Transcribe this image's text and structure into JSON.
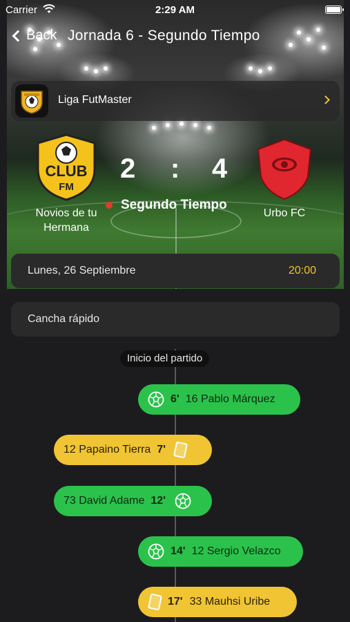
{
  "status_bar": {
    "carrier": "Carrier",
    "time": "2:29 AM"
  },
  "nav": {
    "back_label": "Back",
    "title": "Jornada 6 - Segundo Tiempo"
  },
  "league": {
    "name": "Liga FutMaster",
    "logo_icon": "league-logo-icon"
  },
  "match": {
    "home_team": "Novios de tu Hermana",
    "away_team": "Urbo FC",
    "home_score": "2",
    "separator": ":",
    "away_score": "4",
    "period": "Segundo Tiempo",
    "home_logo_text": "CLUB",
    "home_logo_subtext": "FM"
  },
  "details": {
    "date": "Lunes, 26 Septiembre",
    "time": "20:00",
    "venue": "Cancha rápido"
  },
  "timeline": {
    "start_label": "Inicio del partido",
    "events": [
      {
        "type": "goal",
        "side": "away",
        "minute": "6'",
        "player": "16 Pablo Márquez"
      },
      {
        "type": "card",
        "side": "home",
        "minute": "7'",
        "player": "12 Papaino Tierra"
      },
      {
        "type": "goal",
        "side": "home",
        "minute": "12'",
        "player": "73 David Adame"
      },
      {
        "type": "goal",
        "side": "away",
        "minute": "14'",
        "player": "12 Sergio Velazco"
      },
      {
        "type": "card",
        "side": "away",
        "minute": "17'",
        "player": "33 Mauhsi Uribe"
      }
    ]
  },
  "colors": {
    "accent": "#f2c230",
    "goal": "#2bc24c",
    "card": "#f0c433",
    "live_dot": "#e03b2c",
    "background": "#1c1c1e",
    "away_crest": "#e0262e"
  }
}
